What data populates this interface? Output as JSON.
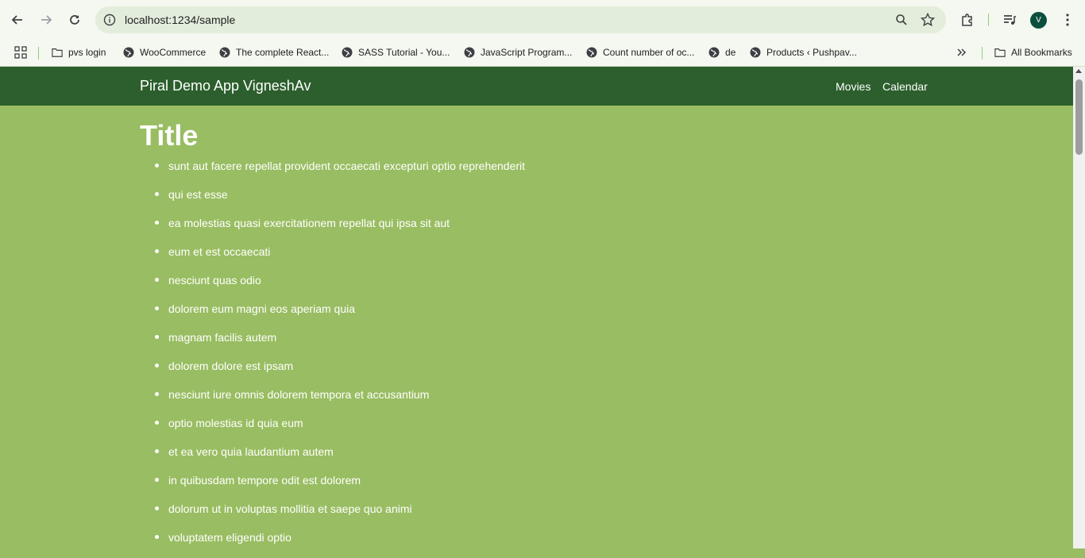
{
  "browser": {
    "url": "localhost:1234/sample",
    "avatar_letter": "V",
    "bookmarks": [
      {
        "label": "pvs login",
        "icon": "folder-icon"
      },
      {
        "label": "WooCommerce",
        "icon": "globe-icon"
      },
      {
        "label": "The complete React...",
        "icon": "globe-icon"
      },
      {
        "label": "SASS Tutorial - You...",
        "icon": "globe-icon"
      },
      {
        "label": "JavaScript Program...",
        "icon": "globe-icon"
      },
      {
        "label": "Count number of oc...",
        "icon": "globe-icon"
      },
      {
        "label": "de",
        "icon": "globe-icon"
      },
      {
        "label": "Products ‹ Pushpav...",
        "icon": "globe-icon"
      }
    ],
    "all_bookmarks": "All Bookmarks"
  },
  "app": {
    "brand": "Piral Demo App VigneshAv",
    "nav": [
      {
        "label": "Movies"
      },
      {
        "label": "Calendar"
      }
    ],
    "title": "Title",
    "items": [
      "sunt aut facere repellat provident occaecati excepturi optio reprehenderit",
      "qui est esse",
      "ea molestias quasi exercitationem repellat qui ipsa sit aut",
      "eum et est occaecati",
      "nesciunt quas odio",
      "dolorem eum magni eos aperiam quia",
      "magnam facilis autem",
      "dolorem dolore est ipsam",
      "nesciunt iure omnis dolorem tempora et accusantium",
      "optio molestias id quia eum",
      "et ea vero quia laudantium autem",
      "in quibusdam tempore odit est dolorem",
      "dolorum ut in voluptas mollitia et saepe quo animi",
      "voluptatem eligendi optio"
    ]
  },
  "colors": {
    "navbar": "#2c5f2d",
    "content_bg": "#99bd62",
    "browser_bg": "#f4f8f0"
  }
}
